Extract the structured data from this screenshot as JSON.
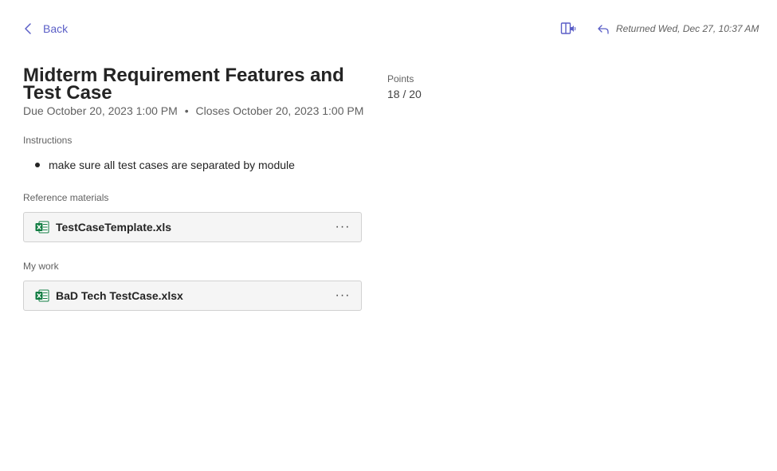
{
  "header": {
    "back_label": "Back",
    "returned_label": "Returned Wed, Dec 27, 10:37 AM",
    "immersive_reader_icon": "immersive-reader-icon",
    "returned_icon": "reply-arrow-icon"
  },
  "assignment": {
    "title": "Midterm Requirement Features and Test Case",
    "due": "Due October 20, 2023 1:00 PM",
    "separator": "•",
    "closes": "Closes October 20, 2023 1:00 PM",
    "points_label": "Points",
    "points_value": "18 / 20"
  },
  "instructions": {
    "label": "Instructions",
    "items": [
      "make sure all test cases  are separated by module"
    ]
  },
  "reference_materials": {
    "label": "Reference materials",
    "files": [
      {
        "name": "TestCaseTemplate.xls",
        "icon": "excel-file-icon",
        "more": "···"
      }
    ]
  },
  "my_work": {
    "label": "My work",
    "files": [
      {
        "name": "BaD Tech TestCase.xlsx",
        "icon": "excel-file-icon",
        "more": "···"
      }
    ]
  },
  "colors": {
    "accent": "#5b5fc7",
    "excel_green": "#107c41",
    "text": "#242424",
    "muted": "#616161"
  }
}
